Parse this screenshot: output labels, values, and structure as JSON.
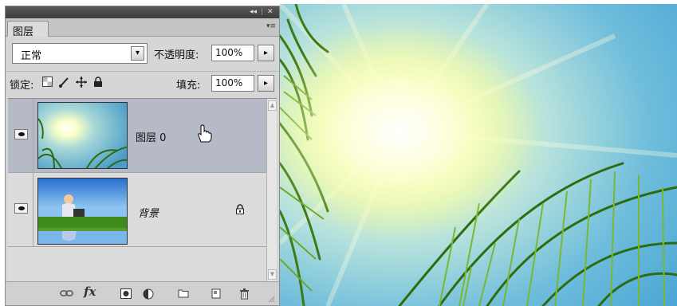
{
  "panel": {
    "tab_label": "图层",
    "collapse_glyph": "◂◂",
    "close_glyph": "✕",
    "menu_glyph": "▾≡"
  },
  "blend": {
    "mode": "正常",
    "arrow": "▾",
    "opacity_label": "不透明度:",
    "opacity_value": "100%",
    "stepper_glyph": "▸"
  },
  "lock": {
    "label": "锁定:",
    "fill_label": "填充:",
    "fill_value": "100%",
    "icons": [
      "transparency-lock-icon",
      "brush-lock-icon",
      "move-lock-icon",
      "padlock-icon"
    ]
  },
  "layers": [
    {
      "name": "图层 0",
      "selected": true,
      "locked": false
    },
    {
      "name": "背景",
      "selected": false,
      "locked": true
    }
  ],
  "scroll": {
    "up": "▲",
    "down": "▼"
  },
  "bottom_icons": [
    "link-icon",
    "fx-icon",
    "mask-icon",
    "adjustment-icon",
    "folder-icon",
    "new-layer-icon",
    "trash-icon"
  ],
  "fx_label": "fx",
  "colors": {
    "panel_bg": "#d6d6d6",
    "selected_row": "#b6b9c6",
    "titlebar": "#4a4a4a"
  }
}
